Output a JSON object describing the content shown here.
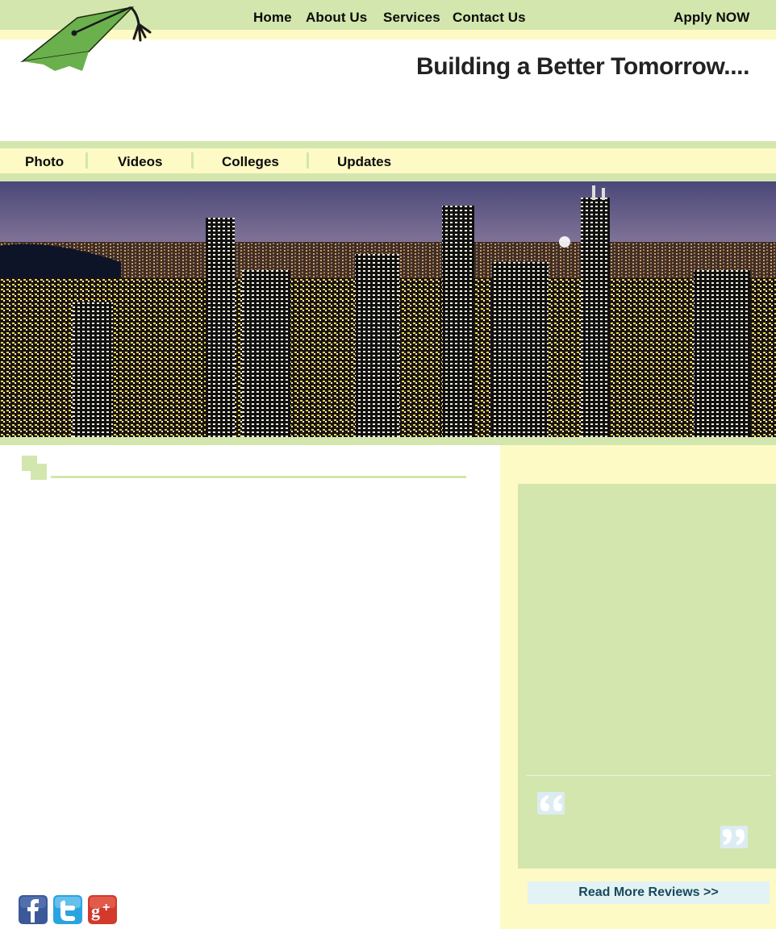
{
  "header": {
    "nav": [
      {
        "label": "Home"
      },
      {
        "label": "About Us"
      },
      {
        "label": "Services"
      },
      {
        "label": "Contact Us"
      }
    ],
    "apply_label": "Apply NOW",
    "tagline": "Building a Better Tomorrow...."
  },
  "subnav": [
    {
      "label": "Photo"
    },
    {
      "label": "Videos"
    },
    {
      "label": "Colleges"
    },
    {
      "label": "Updates"
    }
  ],
  "hero": {
    "image": "city-skyline-at-night"
  },
  "social": [
    {
      "icon": "facebook-icon",
      "color": "#3b5998"
    },
    {
      "icon": "twitter-icon",
      "color": "#2aa4e0"
    },
    {
      "icon": "google-plus-icon",
      "color": "#d23a2b"
    }
  ],
  "reviews": {
    "read_more_label": "Read More Reviews >>"
  },
  "colors": {
    "green": "#d3e6ad",
    "yellow": "#fdfac5",
    "logo_green": "#6ab04c",
    "link_box": "#e3f2f5"
  }
}
